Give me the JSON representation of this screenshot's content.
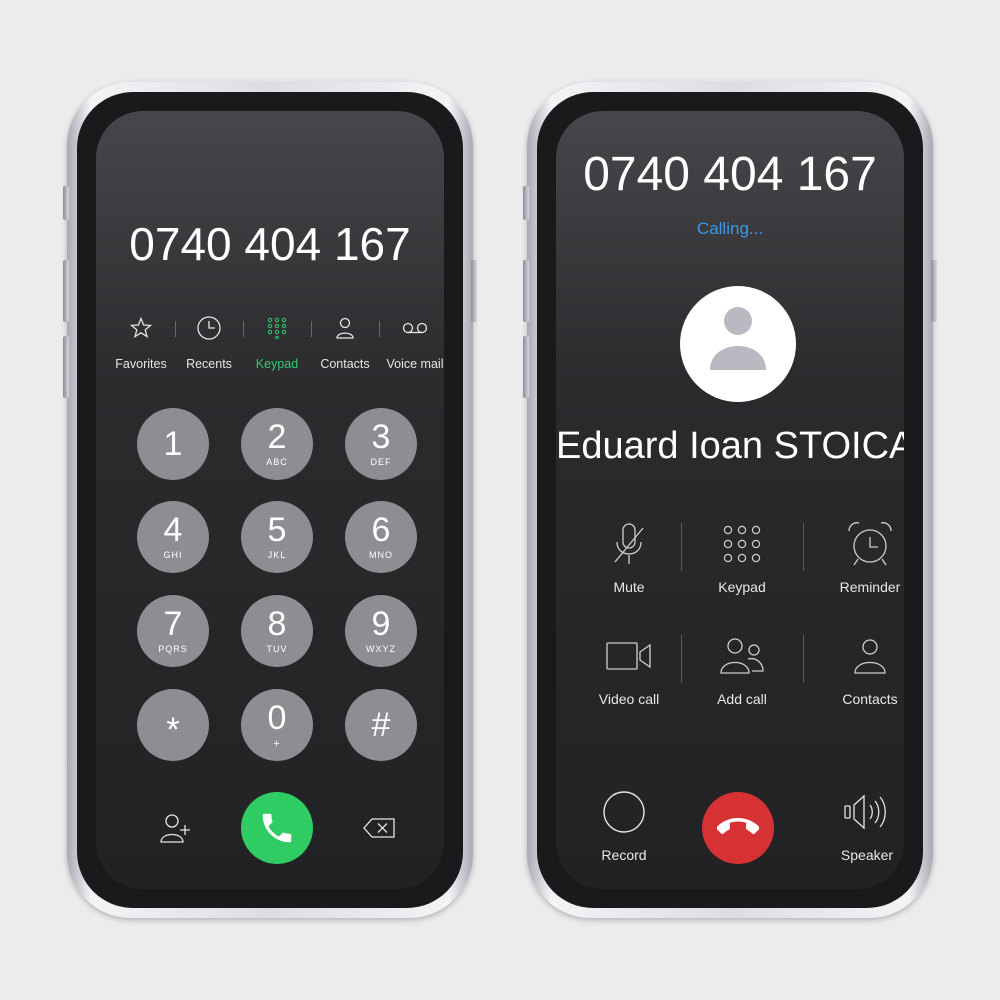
{
  "dialer": {
    "number": "0740 404 167",
    "tabs": [
      {
        "label": "Favorites",
        "icon": "star-icon"
      },
      {
        "label": "Recents",
        "icon": "clock-icon"
      },
      {
        "label": "Keypad",
        "icon": "keypad-icon",
        "active": true
      },
      {
        "label": "Contacts",
        "icon": "contact-icon"
      },
      {
        "label": "Voice mail",
        "icon": "voicemail-icon"
      }
    ],
    "keys": [
      {
        "digit": "1",
        "letters": ""
      },
      {
        "digit": "2",
        "letters": "ABC"
      },
      {
        "digit": "3",
        "letters": "DEF"
      },
      {
        "digit": "4",
        "letters": "GHI"
      },
      {
        "digit": "5",
        "letters": "JKL"
      },
      {
        "digit": "6",
        "letters": "MNO"
      },
      {
        "digit": "7",
        "letters": "PQRS"
      },
      {
        "digit": "8",
        "letters": "TUV"
      },
      {
        "digit": "9",
        "letters": "WXYZ"
      },
      {
        "digit": "*",
        "letters": ""
      },
      {
        "digit": "0",
        "letters": "+"
      },
      {
        "digit": "#",
        "letters": ""
      }
    ],
    "accent_color": "#2ecc71",
    "call_color": "#2ecc62"
  },
  "incall": {
    "number": "0740 404 167",
    "status": "Calling...",
    "caller_name": "Eduard Ioan STOICA",
    "actions": [
      {
        "label": "Mute",
        "icon": "mute-icon"
      },
      {
        "label": "Keypad",
        "icon": "keypad-icon"
      },
      {
        "label": "Reminder",
        "icon": "alarm-clock-icon"
      },
      {
        "label": "Video call",
        "icon": "video-camera-icon"
      },
      {
        "label": "Add call",
        "icon": "add-call-icon"
      },
      {
        "label": "Contacts",
        "icon": "contact-icon"
      }
    ],
    "bottom": {
      "record_label": "Record",
      "speaker_label": "Speaker"
    },
    "status_color": "#3c97e8",
    "end_call_color": "#d63234"
  }
}
